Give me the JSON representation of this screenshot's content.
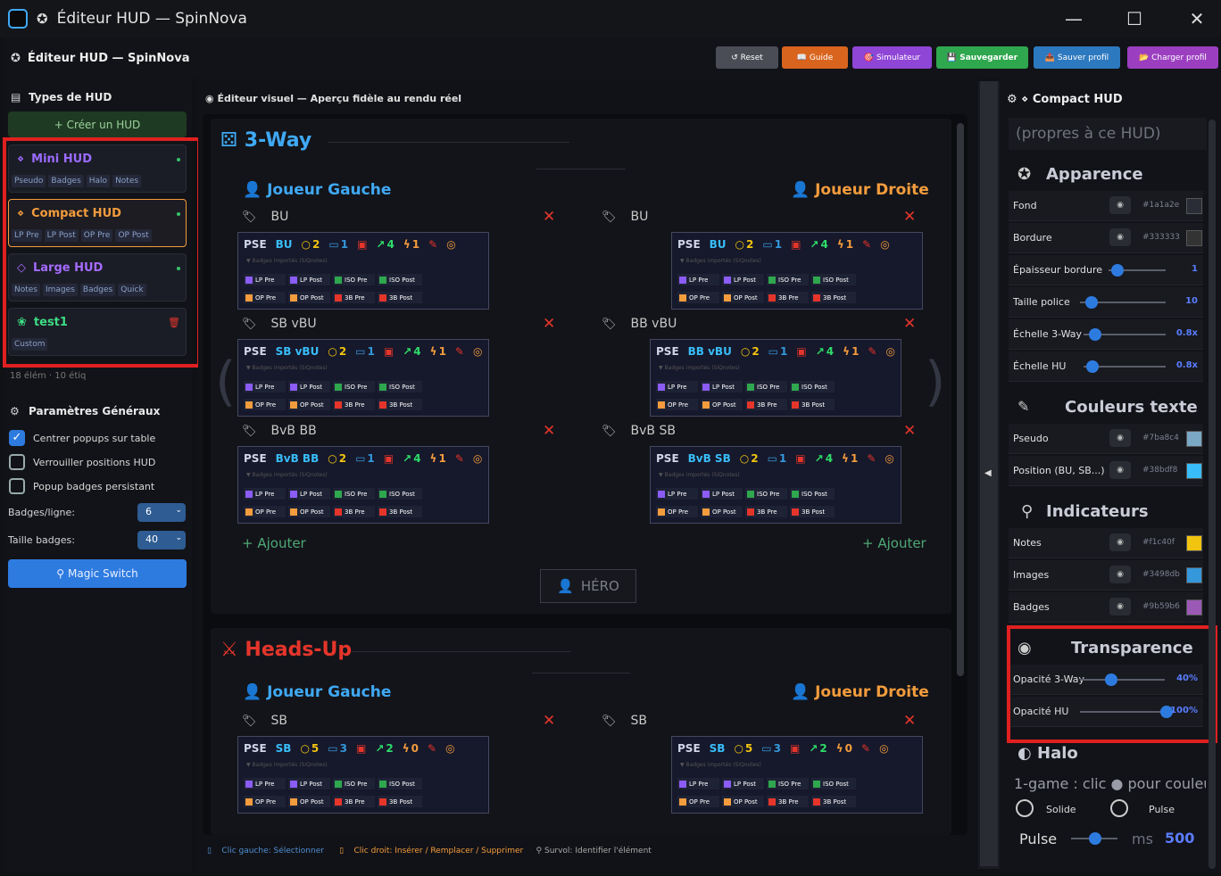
{
  "window": {
    "title": "Éditeur HUD — SpinNova"
  },
  "toolbar": {
    "title": "Éditeur HUD — SpinNova",
    "buttons": [
      {
        "label": "↺ Reset",
        "color": "#4a4d55"
      },
      {
        "label": "📖 Guide",
        "color": "#d9641e"
      },
      {
        "label": "🎯 Simulateur",
        "color": "#8f46d6"
      },
      {
        "label": "💾 Sauvegarder",
        "color": "#2fa74e"
      },
      {
        "label": "📤 Sauver profil",
        "color": "#2d79bf"
      },
      {
        "label": "📂 Charger profil",
        "color": "#9b3fc0"
      }
    ]
  },
  "left": {
    "types_title": "Types de HUD",
    "create": "+ Créer un HUD",
    "huds": [
      {
        "name": "Mini HUD",
        "icon": "⋄",
        "color": "#9b6bff",
        "tags": [
          "Pseudo",
          "Badges",
          "Halo",
          "Notes"
        ]
      },
      {
        "name": "Compact HUD",
        "icon": "⋄",
        "color": "#f39c3d",
        "tags": [
          "LP Pre",
          "LP Post",
          "OP Pre",
          "OP Post"
        ]
      },
      {
        "name": "Large HUD",
        "icon": "◇",
        "color": "#a46bff",
        "tags": [
          "Notes",
          "Images",
          "Badges",
          "Quick"
        ]
      },
      {
        "name": "test1",
        "icon": "❀",
        "color": "#3ddc84",
        "tags": [
          "Custom"
        ]
      }
    ],
    "stats": "18 élém · 10 étiq",
    "general_title": "Paramètres Généraux",
    "checks": [
      {
        "label": "Centrer popups sur table",
        "on": true
      },
      {
        "label": "Verrouiller positions HUD",
        "on": false
      },
      {
        "label": "Popup badges persistant",
        "on": false
      }
    ],
    "badges_per_line_label": "Badges/ligne:",
    "badges_per_line": "6",
    "badge_size_label": "Taille badges:",
    "badge_size": "40",
    "magic": "Magic Switch"
  },
  "center": {
    "header": "Éditeur visuel — Aperçu fidèle au rendu réel",
    "sec3": "3-Way",
    "secHU": "Heads-Up",
    "player_left": "Joueur Gauche",
    "player_right": "Joueur Droite",
    "add": "+ Ajouter",
    "hero": "HÉRO",
    "subtitle": "▼ Badges importés (SiQnotes)",
    "row1": [
      "LP Pre",
      "LP Post",
      "ISO Pre",
      "ISO Post"
    ],
    "row2": [
      "OP Pre",
      "OP Post",
      "3B Pre",
      "3B Post"
    ],
    "status": [
      "Clic gauche: Sélectionner",
      "Clic droit: Insérer / Remplacer / Supprimer",
      "Survol: Identifier l'élément"
    ]
  },
  "threeway": [
    {
      "side": "L",
      "pos": "BU",
      "chat": "2",
      "disp": "1",
      "flash": "4",
      "bolt": "1"
    },
    {
      "side": "R",
      "pos": "BU",
      "chat": "2",
      "disp": "1",
      "flash": "4",
      "bolt": "1"
    },
    {
      "side": "L",
      "pos": "SB vBU",
      "chat": "2",
      "disp": "1",
      "flash": "4",
      "bolt": "1"
    },
    {
      "side": "R",
      "pos": "BB vBU",
      "chat": "2",
      "disp": "1",
      "flash": "4",
      "bolt": "1"
    },
    {
      "side": "L",
      "pos": "BvB BB",
      "chat": "2",
      "disp": "1",
      "flash": "4",
      "bolt": "1"
    },
    {
      "side": "R",
      "pos": "BvB SB",
      "chat": "2",
      "disp": "1",
      "flash": "4",
      "bolt": "1"
    }
  ],
  "headsup": [
    {
      "side": "L",
      "pos": "SB",
      "chat": "5",
      "disp": "3",
      "flash": "2",
      "bolt": "0"
    },
    {
      "side": "R",
      "pos": "SB",
      "chat": "5",
      "disp": "3",
      "flash": "2",
      "bolt": "0"
    }
  ],
  "right": {
    "title": "⚙ ⋄ Compact HUD",
    "note": "(propres à ce HUD)",
    "apparence": "Apparence",
    "couleurs": "Couleurs texte",
    "indicateurs": "Indicateurs",
    "transparence": "Transparence",
    "halo": "Halo",
    "fond": {
      "label": "Fond",
      "hex": "#1a1a2e"
    },
    "bordure": {
      "label": "Bordure",
      "hex": "#333333"
    },
    "epaisseur": {
      "label": "Épaisseur bordure",
      "value": "1"
    },
    "taille": {
      "label": "Taille police",
      "value": "10"
    },
    "echelle3": {
      "label": "Échelle 3-Way",
      "value": "0.8x"
    },
    "echelleHU": {
      "label": "Échelle HU",
      "value": "0.8x"
    },
    "pseudo": {
      "label": "Pseudo",
      "hex": "#7ba8c4",
      "color": "#7ba8c4"
    },
    "position": {
      "label": "Position (BU, SB...)",
      "hex": "#38bdf8",
      "color": "#38bdf8"
    },
    "notes": {
      "label": "Notes",
      "hex": "#f1c40f",
      "color": "#f1c40f"
    },
    "images": {
      "label": "Images",
      "hex": "#3498db",
      "color": "#3498db"
    },
    "badges": {
      "label": "Badges",
      "hex": "#9b59b6",
      "color": "#9b59b6"
    },
    "op3": {
      "label": "Opacité 3-Way",
      "value": "40%"
    },
    "opHU": {
      "label": "Opacité HU",
      "value": "100%"
    },
    "halo_text": "1-game : clic ● pour couleu",
    "solide": "Solide",
    "pulse_radio": "Pulse",
    "pulse": "Pulse",
    "ms": "ms",
    "pulse_val": "500"
  }
}
